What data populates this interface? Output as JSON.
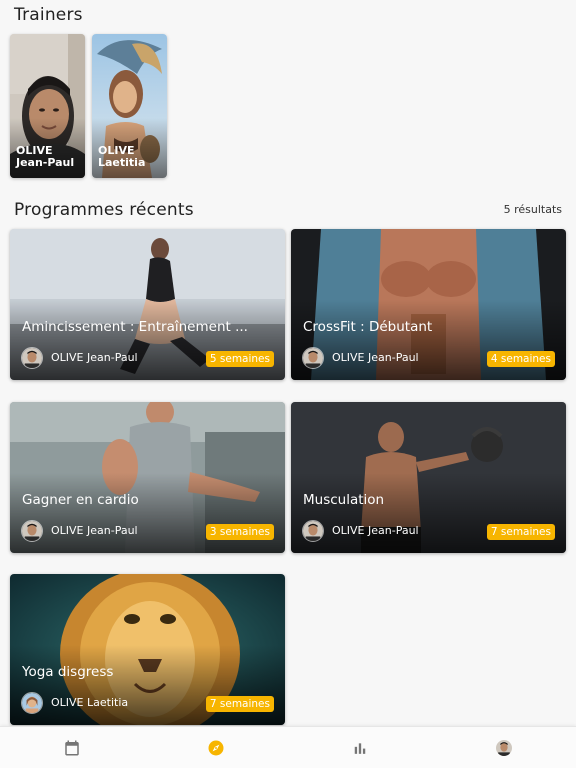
{
  "trainers_section": {
    "title": "Trainers",
    "trainers": [
      {
        "last_name": "OLIVE",
        "first_name": "Jean-Paul"
      },
      {
        "last_name": "OLIVE",
        "first_name": "Laetitia"
      }
    ]
  },
  "programmes_section": {
    "title": "Programmes récents",
    "results": "5 résultats",
    "programmes": [
      {
        "title": "Amincissement :  Entraînement ...",
        "trainer": "OLIVE Jean-Paul",
        "duration": "5 semaines"
      },
      {
        "title": "CrossFit : Débutant",
        "trainer": "OLIVE Jean-Paul",
        "duration": "4 semaines"
      },
      {
        "title": "Gagner en cardio",
        "trainer": "OLIVE Jean-Paul",
        "duration": "3 semaines"
      },
      {
        "title": "Musculation",
        "trainer": "OLIVE Jean-Paul",
        "duration": "7 semaines"
      },
      {
        "title": "Yoga disgress",
        "trainer": "OLIVE Laetitia",
        "duration": "7 semaines"
      }
    ]
  },
  "bottom_nav": {
    "items": [
      {
        "icon": "calendar-icon",
        "active": false
      },
      {
        "icon": "compass-icon",
        "active": true
      },
      {
        "icon": "bar-chart-icon",
        "active": false
      },
      {
        "icon": "profile-avatar",
        "active": false
      }
    ]
  },
  "colors": {
    "accent": "#f7b500",
    "background": "#f7f7f7",
    "nav_inactive": "#757575"
  }
}
